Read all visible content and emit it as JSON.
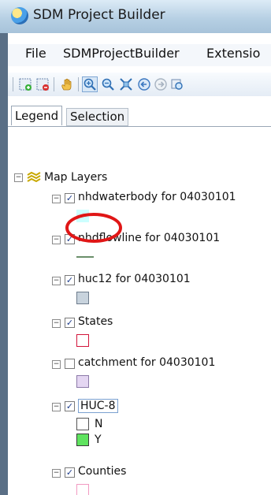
{
  "window": {
    "title": "SDM Project Builder"
  },
  "menu": {
    "items": [
      "File",
      "SDMProjectBuilder",
      "Extensio"
    ]
  },
  "tabs": {
    "legend": "Legend",
    "selection": "Selection"
  },
  "tree": {
    "root": "Map Layers",
    "layers": [
      {
        "label": "nhdwaterbody for 04030101",
        "checked": true,
        "symbol": "fill",
        "fill": "#ccffff",
        "stroke": "#ccffff"
      },
      {
        "label": "nhdflowline for 04030101",
        "checked": true,
        "symbol": "line",
        "stroke": "#6a8f6a"
      },
      {
        "label": "huc12 for 04030101",
        "checked": true,
        "symbol": "fill",
        "fill": "#c8d3dd",
        "stroke": "#6d7c8c"
      },
      {
        "label": "States",
        "checked": true,
        "symbol": "fill",
        "fill": "#ffffff",
        "stroke": "#d2143a"
      },
      {
        "label": "catchment for 04030101",
        "checked": false,
        "symbol": "fill",
        "fill": "#e4d6f2",
        "stroke": "#8c7aa8"
      },
      {
        "label": "HUC-8",
        "checked": true,
        "highlighted": true,
        "categories": [
          {
            "label": "N",
            "fill": "#ffffff",
            "stroke": "#555555"
          },
          {
            "label": "Y",
            "fill": "#5fe35f",
            "stroke": "#3a3a3a"
          }
        ]
      },
      {
        "label": "Counties",
        "checked": true,
        "symbol": "fill",
        "fill": "#ffffff",
        "stroke": "#f29ac2"
      }
    ]
  },
  "annotation": {
    "circle_color": "#e01616"
  }
}
